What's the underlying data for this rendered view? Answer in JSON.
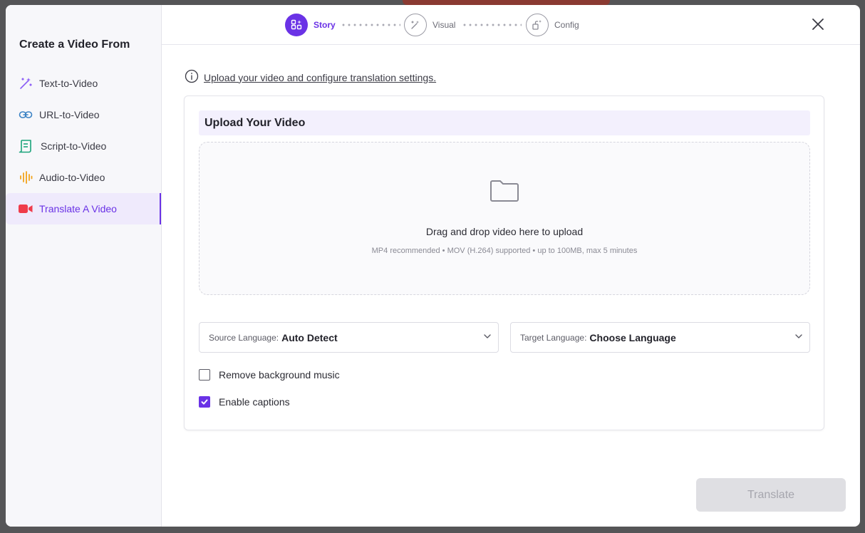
{
  "sidebar": {
    "title": "Create a Video From",
    "items": [
      {
        "label": "Text-to-Video",
        "icon": "magic-wand-icon",
        "color": "#8b5cf6"
      },
      {
        "label": "URL-to-Video",
        "icon": "link-icon",
        "color": "#3b82c4"
      },
      {
        "label": "Script-to-Video",
        "icon": "script-scroll-icon",
        "color": "#1aa37a"
      },
      {
        "label": "Audio-to-Video",
        "icon": "audio-wave-icon",
        "color": "#f2a31b"
      },
      {
        "label": "Translate A Video",
        "icon": "video-camera-icon",
        "color": "#ef3b4a",
        "active": true
      }
    ]
  },
  "stepper": {
    "steps": [
      {
        "label": "Story",
        "icon": "story-icon",
        "active": true
      },
      {
        "label": "Visual",
        "icon": "visual-wand-icon",
        "active": false
      },
      {
        "label": "Config",
        "icon": "config-icon",
        "active": false
      }
    ]
  },
  "info": {
    "text": "Upload your video and configure translation settings."
  },
  "upload": {
    "title": "Upload Your Video",
    "drop_text": "Drag and drop video here to upload",
    "hint": "MP4 recommended • MOV (H.264) supported • up to 100MB, max 5 minutes"
  },
  "source_language": {
    "label": "Source Language:",
    "value": "Auto Detect"
  },
  "target_language": {
    "label": "Target Language:",
    "value": "Choose Language"
  },
  "options": {
    "remove_music": {
      "label": "Remove background music",
      "checked": false
    },
    "captions": {
      "label": "Enable captions",
      "checked": true
    }
  },
  "actions": {
    "translate_label": "Translate"
  },
  "colors": {
    "accent": "#6a32e6",
    "accent_bg": "#efeafc",
    "disabled_btn": "#dfdfe3"
  }
}
